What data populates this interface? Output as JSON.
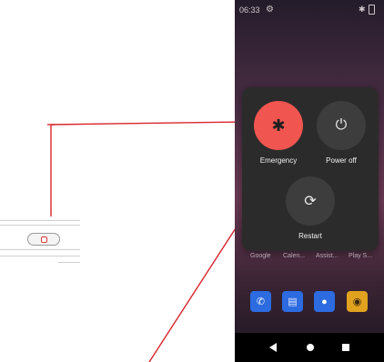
{
  "statusbar": {
    "time": "06:33",
    "settings_icon": "gear-icon",
    "bluetooth_icon": "bluetooth-icon",
    "battery_icon": "battery-icon"
  },
  "power_menu": {
    "emergency": {
      "label": "Emergency",
      "icon": "asterisk-icon",
      "glyph": "✱"
    },
    "power_off": {
      "label": "Power off",
      "icon": "power-icon",
      "glyph": "⏻"
    },
    "restart": {
      "label": "Restart",
      "icon": "restart-icon",
      "glyph": "⟳"
    }
  },
  "home_apps": [
    "Google",
    "Calen...",
    "Assist...",
    "Play S..."
  ],
  "dock": [
    {
      "name": "phone",
      "icon": "phone-icon",
      "glyph": "✆",
      "bg": "#2c6be0",
      "fg": "#ffffff"
    },
    {
      "name": "messages",
      "icon": "messages-icon",
      "glyph": "▤",
      "bg": "#2c6be0",
      "fg": "#dfe8ff"
    },
    {
      "name": "contacts",
      "icon": "contacts-icon",
      "glyph": "●",
      "bg": "#2c6be0",
      "fg": "#ffffff"
    },
    {
      "name": "camera",
      "icon": "camera-icon",
      "glyph": "◉",
      "bg": "#e0a21f",
      "fg": "#3a2a10"
    }
  ],
  "colors": {
    "callout_line": "#d7262e",
    "emergency": "#f1554f",
    "menu_bg": "#2b2b2b"
  }
}
